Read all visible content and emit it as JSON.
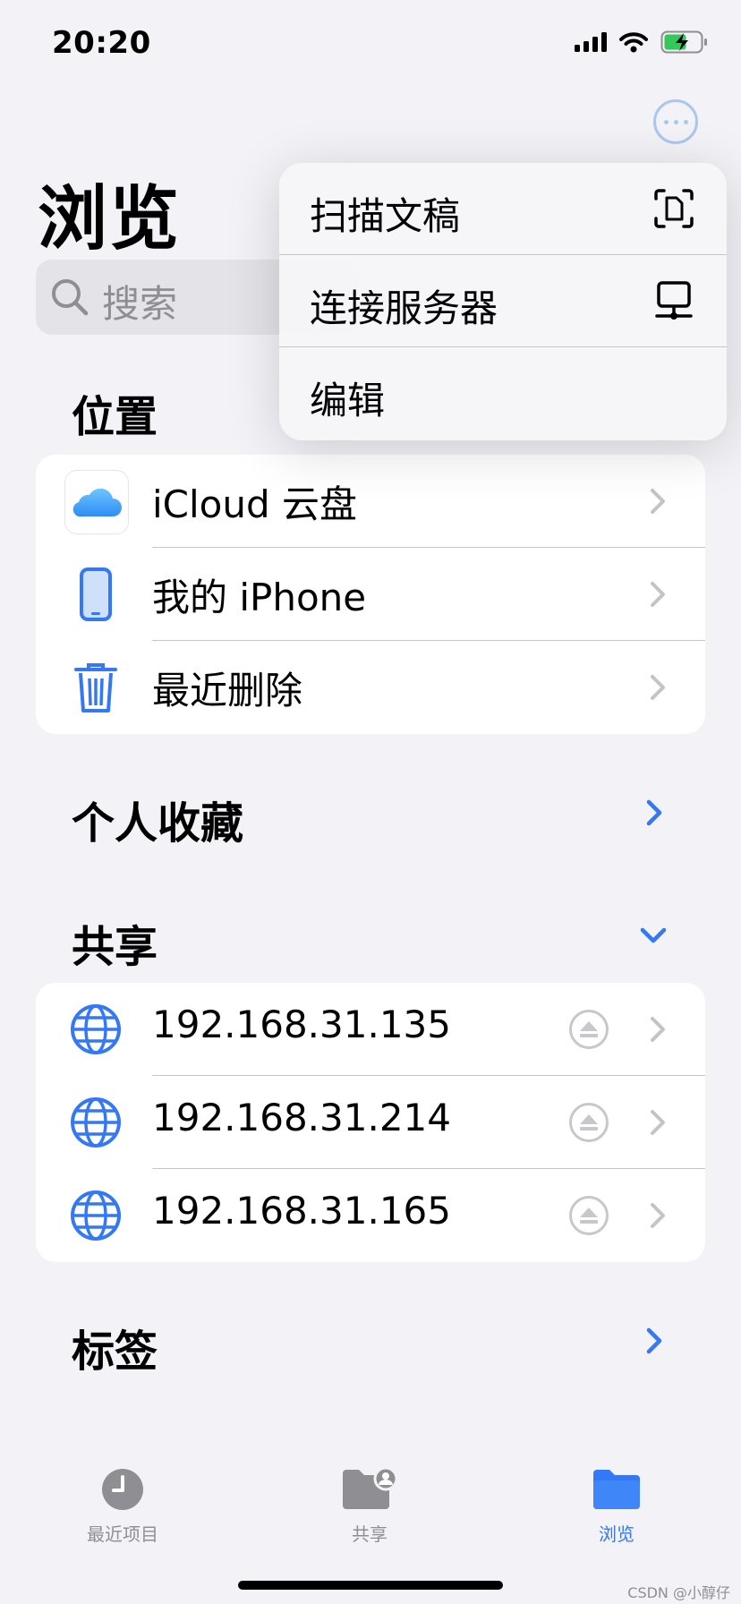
{
  "status": {
    "time": "20:20"
  },
  "header": {
    "title": "浏览",
    "search_placeholder": "搜索"
  },
  "menu": {
    "items": [
      {
        "label": "扫描文稿",
        "icon": "scan-document-icon"
      },
      {
        "label": "连接服务器",
        "icon": "connect-server-icon"
      },
      {
        "label": "编辑"
      }
    ]
  },
  "locations": {
    "title": "位置",
    "items": [
      {
        "label": "iCloud 云盘",
        "icon": "icloud-icon"
      },
      {
        "label": "我的 iPhone",
        "icon": "iphone-icon"
      },
      {
        "label": "最近删除",
        "icon": "trash-icon"
      }
    ]
  },
  "favorites": {
    "title": "个人收藏"
  },
  "shared": {
    "title": "共享",
    "items": [
      {
        "label": "192.168.31.135",
        "icon": "globe-icon"
      },
      {
        "label": "192.168.31.214",
        "icon": "globe-icon"
      },
      {
        "label": "192.168.31.165",
        "icon": "globe-icon"
      }
    ]
  },
  "tags": {
    "title": "标签"
  },
  "tabbar": {
    "tabs": [
      {
        "label": "最近项目",
        "icon": "clock-icon"
      },
      {
        "label": "共享",
        "icon": "shared-folder-icon"
      },
      {
        "label": "浏览",
        "icon": "folder-icon"
      }
    ],
    "active_color": "#3478f6",
    "inactive_color": "#8e8e93"
  },
  "watermark": "CSDN @小醇仔"
}
